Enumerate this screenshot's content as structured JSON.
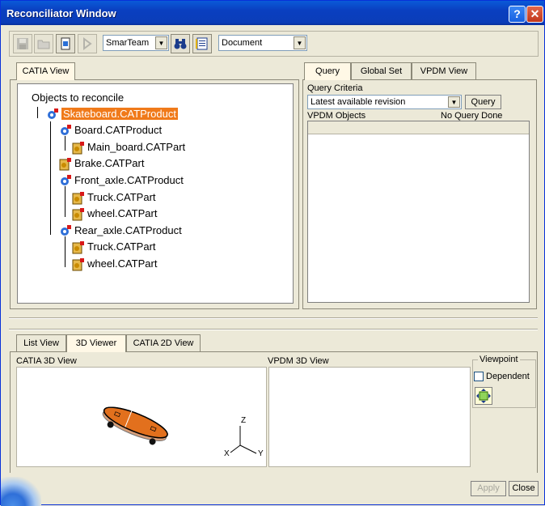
{
  "window": {
    "title": "Reconciliator Window"
  },
  "toolbar": {
    "team_combo": "SmarTeam",
    "type_combo": "Document"
  },
  "left_tabs": [
    {
      "label": "CATIA View"
    }
  ],
  "tree": {
    "root_label": "Objects to reconcile",
    "nodes": [
      {
        "label": "Skateboard.CATProduct",
        "selected": true
      },
      {
        "label": "Board.CATProduct"
      },
      {
        "label": "Main_board.CATPart"
      },
      {
        "label": "Brake.CATPart"
      },
      {
        "label": "Front_axle.CATProduct"
      },
      {
        "label": "Truck.CATPart"
      },
      {
        "label": "wheel.CATPart"
      },
      {
        "label": "Rear_axle.CATProduct"
      },
      {
        "label": "Truck.CATPart"
      },
      {
        "label": "wheel.CATPart"
      }
    ]
  },
  "right_tabs": [
    {
      "label": "Query"
    },
    {
      "label": "Global Set"
    },
    {
      "label": "VPDM View"
    }
  ],
  "query": {
    "criteria_label": "Query Criteria",
    "criteria_value": "Latest available revision",
    "query_button": "Query",
    "objects_label": "VPDM Objects",
    "status": "No Query Done"
  },
  "bottom_tabs": [
    {
      "label": "List View"
    },
    {
      "label": "3D Viewer"
    },
    {
      "label": "CATIA 2D View"
    }
  ],
  "viewer": {
    "catia_label": "CATIA 3D View",
    "vpdm_label": "VPDM 3D View",
    "axis_z": "Z",
    "axis_x": "X",
    "axis_y": "Y"
  },
  "viewpoint": {
    "group_label": "Viewpoint",
    "dependent_label": "Dependent"
  },
  "footer": {
    "apply": "Apply",
    "close": "Close"
  }
}
